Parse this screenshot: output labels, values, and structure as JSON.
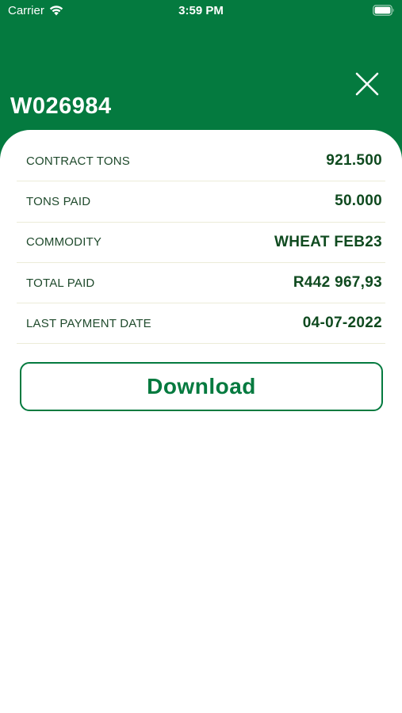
{
  "status_bar": {
    "carrier": "Carrier",
    "time": "3:59 PM",
    "wifi_icon": "wifi-icon",
    "battery_icon": "battery-full-icon"
  },
  "header": {
    "title": "W026984",
    "close_icon": "close-icon",
    "background_color": "#047a3f"
  },
  "details": [
    {
      "label": "CONTRACT TONS",
      "value": "921.500"
    },
    {
      "label": "TONS PAID",
      "value": "50.000"
    },
    {
      "label": "COMMODITY",
      "value": "WHEAT FEB23"
    },
    {
      "label": "TOTAL PAID",
      "value": "R442 967,93"
    },
    {
      "label": "LAST PAYMENT DATE",
      "value": "04-07-2022"
    }
  ],
  "actions": {
    "download_label": "Download"
  },
  "colors": {
    "accent": "#047a3f",
    "value_text": "#0f4a1f",
    "divider": "#ececd8"
  }
}
